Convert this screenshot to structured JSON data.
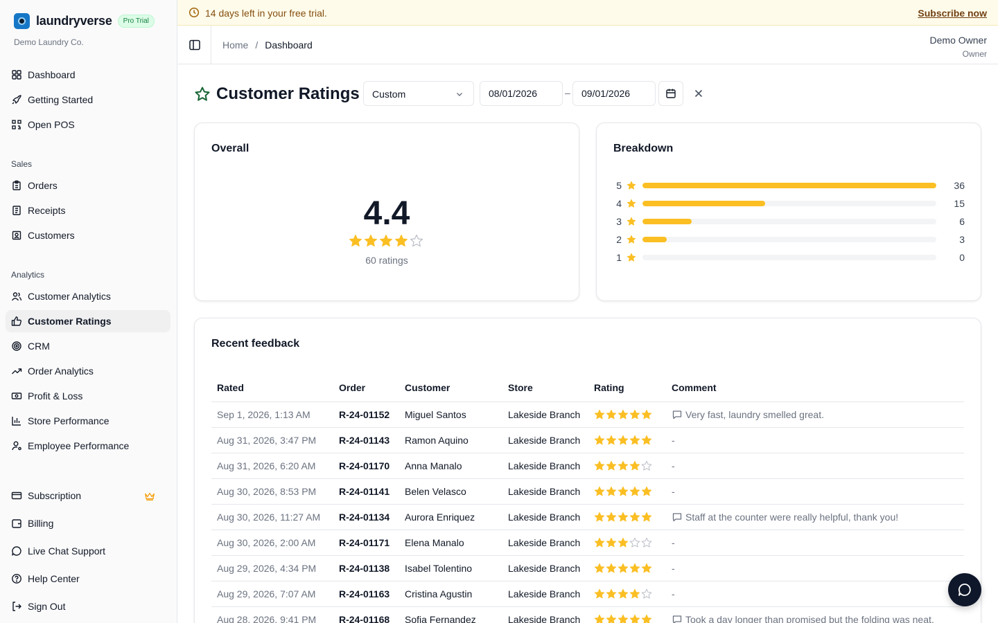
{
  "app": {
    "name": "laundryverse",
    "badge": "Pro Trial",
    "org": "Demo Laundry Co."
  },
  "colors": {
    "brand": "#1677c6",
    "star": "#fbbf24",
    "banner_bg": "#fefbea",
    "crown": "#f59e0b"
  },
  "sidebar": {
    "top": [
      {
        "label": "Dashboard",
        "icon": "grid-icon"
      },
      {
        "label": "Getting Started",
        "icon": "rocket-icon"
      },
      {
        "label": "Open POS",
        "icon": "qr-code-icon"
      }
    ],
    "sales_section": "Sales",
    "sales": [
      {
        "label": "Orders",
        "icon": "clipboard-icon"
      },
      {
        "label": "Receipts",
        "icon": "receipt-icon"
      },
      {
        "label": "Customers",
        "icon": "contact-icon"
      }
    ],
    "analytics_section": "Analytics",
    "analytics": [
      {
        "label": "Customer Analytics",
        "icon": "users-icon"
      },
      {
        "label": "Customer Ratings",
        "icon": "thumbs-up-icon",
        "active": true
      },
      {
        "label": "CRM",
        "icon": "target-icon"
      },
      {
        "label": "Order Analytics",
        "icon": "trending-up-icon"
      },
      {
        "label": "Profit & Loss",
        "icon": "banknote-icon"
      },
      {
        "label": "Store Performance",
        "icon": "bar-chart-icon"
      },
      {
        "label": "Employee Performance",
        "icon": "user-cog-icon"
      }
    ],
    "bottom": [
      {
        "label": "Subscription",
        "icon": "credit-card-icon"
      },
      {
        "label": "Billing",
        "icon": "wallet-icon"
      },
      {
        "label": "Live Chat Support",
        "icon": "chat-bubble-icon"
      },
      {
        "label": "Help Center",
        "icon": "help-circle-icon"
      },
      {
        "label": "Sign Out",
        "icon": "log-out-icon"
      }
    ]
  },
  "banner": {
    "text": "14 days left in your free trial.",
    "link": "Subscribe now"
  },
  "header": {
    "breadcrumb_home": "Home",
    "breadcrumb_sep": "/",
    "breadcrumb_current": "Dashboard",
    "user_name": "Demo Owner",
    "user_role": "Owner"
  },
  "page": {
    "title": "Customer Ratings",
    "range_select": "Custom",
    "date_from": "08/01/2026",
    "date_sep": "–",
    "date_to": "09/01/2026"
  },
  "overall": {
    "title": "Overall",
    "value": "4.4",
    "stars_filled": 4,
    "count_text": "60 ratings"
  },
  "breakdown": {
    "title": "Breakdown",
    "rows": [
      {
        "stars": "5",
        "count": "36",
        "fraction": 1.0
      },
      {
        "stars": "4",
        "count": "15",
        "fraction": 0.4167
      },
      {
        "stars": "3",
        "count": "6",
        "fraction": 0.1667
      },
      {
        "stars": "2",
        "count": "3",
        "fraction": 0.0833
      },
      {
        "stars": "1",
        "count": "0",
        "fraction": 0
      }
    ]
  },
  "feedback": {
    "title": "Recent feedback",
    "columns": [
      "Rated",
      "Order",
      "Customer",
      "Store",
      "Rating",
      "Comment"
    ],
    "rows": [
      {
        "rated": "Sep 1, 2026, 1:13 AM",
        "order": "R-24-01152",
        "customer": "Miguel Santos",
        "store": "Lakeside Branch",
        "rating": 5,
        "comment": "Very fast, laundry smelled great."
      },
      {
        "rated": "Aug 31, 2026, 3:47 PM",
        "order": "R-24-01143",
        "customer": "Ramon Aquino",
        "store": "Lakeside Branch",
        "rating": 5,
        "comment": "-"
      },
      {
        "rated": "Aug 31, 2026, 6:20 AM",
        "order": "R-24-01170",
        "customer": "Anna Manalo",
        "store": "Lakeside Branch",
        "rating": 4,
        "comment": "-"
      },
      {
        "rated": "Aug 30, 2026, 8:53 PM",
        "order": "R-24-01141",
        "customer": "Belen Velasco",
        "store": "Lakeside Branch",
        "rating": 5,
        "comment": "-"
      },
      {
        "rated": "Aug 30, 2026, 11:27 AM",
        "order": "R-24-01134",
        "customer": "Aurora Enriquez",
        "store": "Lakeside Branch",
        "rating": 5,
        "comment": "Staff at the counter were really helpful, thank you!"
      },
      {
        "rated": "Aug 30, 2026, 2:00 AM",
        "order": "R-24-01171",
        "customer": "Elena Manalo",
        "store": "Lakeside Branch",
        "rating": 3,
        "comment": "-"
      },
      {
        "rated": "Aug 29, 2026, 4:34 PM",
        "order": "R-24-01138",
        "customer": "Isabel Tolentino",
        "store": "Lakeside Branch",
        "rating": 5,
        "comment": "-"
      },
      {
        "rated": "Aug 29, 2026, 7:07 AM",
        "order": "R-24-01163",
        "customer": "Cristina Agustin",
        "store": "Lakeside Branch",
        "rating": 4,
        "comment": "-"
      },
      {
        "rated": "Aug 28, 2026, 9:41 PM",
        "order": "R-24-01168",
        "customer": "Sofia Fernandez",
        "store": "Lakeside Branch",
        "rating": 5,
        "comment": "Took a day longer than promised but the folding was neat."
      }
    ]
  }
}
